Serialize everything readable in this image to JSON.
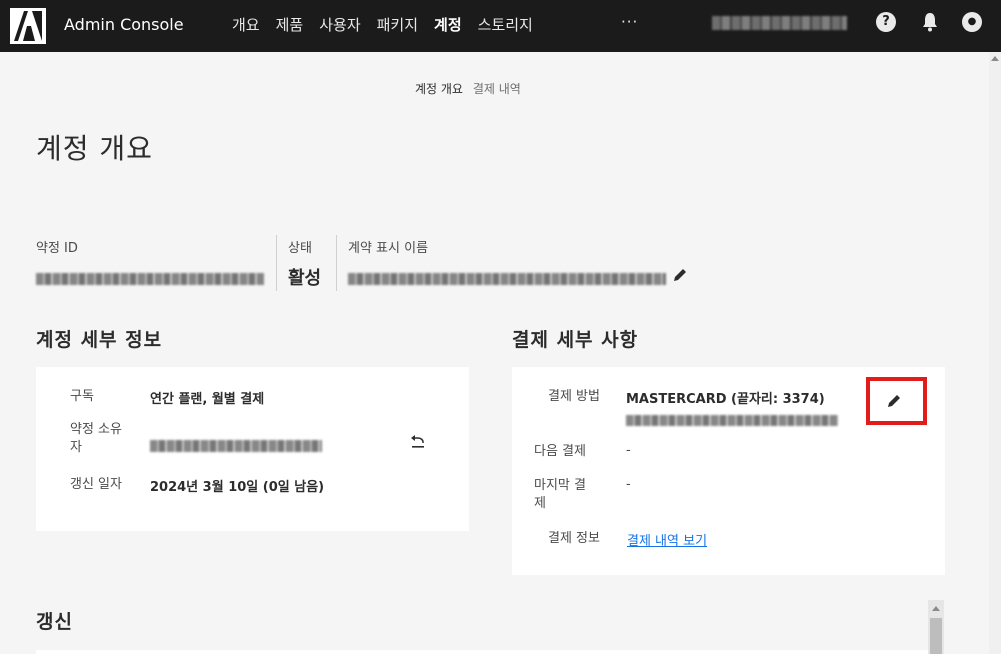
{
  "header": {
    "app_title": "Admin Console",
    "nav": [
      "개요",
      "제품",
      "사용자",
      "패키지",
      "계정",
      "스토리지"
    ],
    "active_nav": "계정",
    "more": "···",
    "help_glyph": "?",
    "avatar_glyph": "●",
    "icons": [
      "adobe-logo-icon",
      "help-icon",
      "bell-icon",
      "user-avatar-icon"
    ]
  },
  "breadcrumb": {
    "current": "계정 개요",
    "link": "결제 내역"
  },
  "page_title": "계정 개요",
  "meta": {
    "contract_id_label": "약정 ID",
    "status_label": "상태",
    "status_value": "활성",
    "display_name_label": "계약 표시 이름"
  },
  "account_details": {
    "title": "계정 세부 정보",
    "subscription_label": "구독",
    "subscription_value": "연간 플랜, 월별 결제",
    "owner_label": "약정 소유자",
    "renewal_label": "갱신 일자",
    "renewal_value": "2024년 3월 10일 (0일 남음)"
  },
  "payment_details": {
    "title": "결제 세부 사항",
    "method_label": "결제 방법",
    "method_value": "MASTERCARD (끝자리: 3374)",
    "next_label": "다음 결제",
    "next_value": "-",
    "last_label": "마지막 결제",
    "last_value": "-",
    "info_label": "결제 정보",
    "info_link": "결제 내역 보기"
  },
  "renewal_section": {
    "title": "갱신"
  },
  "colors": {
    "topbar": "#1b1b1b",
    "link": "#1473e6",
    "highlight": "#e21b1b"
  }
}
